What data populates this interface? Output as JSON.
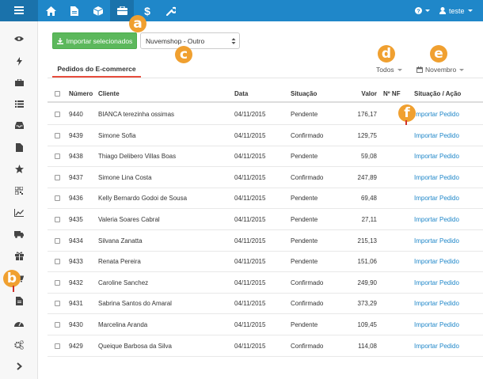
{
  "topbar": {
    "icons": [
      "menu-icon",
      "home-icon",
      "document-icon",
      "box-icon",
      "briefcase-icon",
      "dollar-icon",
      "wrench-icon"
    ],
    "help_icon": "question-circle-icon",
    "user_icon": "user-icon",
    "user_label": "teste"
  },
  "sidebar": {
    "icons": [
      "eye-icon",
      "bolt-icon",
      "briefcase-icon",
      "list-icon",
      "inbox-icon",
      "file-icon",
      "star-icon",
      "qrcode-icon",
      "line-chart-icon",
      "truck-icon",
      "gift-icon",
      "cart-icon",
      "file-text-icon",
      "dashboard-icon",
      "cogs-icon",
      "chevron-right-icon"
    ]
  },
  "toolbar": {
    "import_label": "Importar selecionados",
    "store_select": "Nuvemshop - Outro"
  },
  "tabs": {
    "active_label": "Pedidos do E-commerce"
  },
  "filters": {
    "status_label": "Todos",
    "month_label": "Novembro"
  },
  "table": {
    "headers": [
      "Número",
      "Cliente",
      "Data",
      "Situação",
      "Valor",
      "Nº NF",
      "Situação / Ação"
    ],
    "rows": [
      {
        "numero": "9440",
        "cliente": "BIANCA terezinha ossimas",
        "data": "04/11/2015",
        "situacao": "Pendente",
        "valor": "176,17",
        "nf": "",
        "acao": "Importar Pedido"
      },
      {
        "numero": "9439",
        "cliente": "Simone Sofia",
        "data": "04/11/2015",
        "situacao": "Confirmado",
        "valor": "129,75",
        "nf": "",
        "acao": "Importar Pedido"
      },
      {
        "numero": "9438",
        "cliente": "Thiago Delibero Villas Boas",
        "data": "04/11/2015",
        "situacao": "Pendente",
        "valor": "59,08",
        "nf": "",
        "acao": "Importar Pedido"
      },
      {
        "numero": "9437",
        "cliente": "Simone Lina Costa",
        "data": "04/11/2015",
        "situacao": "Confirmado",
        "valor": "247,89",
        "nf": "",
        "acao": "Importar Pedido"
      },
      {
        "numero": "9436",
        "cliente": "Kelly Bernardo Godoi de Sousa",
        "data": "04/11/2015",
        "situacao": "Pendente",
        "valor": "69,48",
        "nf": "",
        "acao": "Importar Pedido"
      },
      {
        "numero": "9435",
        "cliente": "Valeria Soares Cabral",
        "data": "04/11/2015",
        "situacao": "Pendente",
        "valor": "27,11",
        "nf": "",
        "acao": "Importar Pedido"
      },
      {
        "numero": "9434",
        "cliente": "Silvana Zanatta",
        "data": "04/11/2015",
        "situacao": "Pendente",
        "valor": "215,13",
        "nf": "",
        "acao": "Importar Pedido"
      },
      {
        "numero": "9433",
        "cliente": "Renata Pereira",
        "data": "04/11/2015",
        "situacao": "Pendente",
        "valor": "151,06",
        "nf": "",
        "acao": "Importar Pedido"
      },
      {
        "numero": "9432",
        "cliente": "Caroline Sanchez",
        "data": "04/11/2015",
        "situacao": "Confirmado",
        "valor": "249,90",
        "nf": "",
        "acao": "Importar Pedido"
      },
      {
        "numero": "9431",
        "cliente": "Sabrina Santos do Amaral",
        "data": "04/11/2015",
        "situacao": "Confirmado",
        "valor": "373,29",
        "nf": "",
        "acao": "Importar Pedido"
      },
      {
        "numero": "9430",
        "cliente": "Marcelina Aranda",
        "data": "04/11/2015",
        "situacao": "Pendente",
        "valor": "109,45",
        "nf": "",
        "acao": "Importar Pedido"
      },
      {
        "numero": "9429",
        "cliente": "Queique Barbosa da Silva",
        "data": "04/11/2015",
        "situacao": "Confirmado",
        "valor": "114,08",
        "nf": "",
        "acao": "Importar Pedido"
      }
    ]
  },
  "annotations": {
    "a": "a",
    "b": "b",
    "c": "c",
    "d": "d",
    "e": "e",
    "f": "f"
  },
  "colors": {
    "topbar": "#1f87c9",
    "topbar_active": "#1a72ab",
    "import_button": "#5cb85c",
    "link": "#1f87c9",
    "tab_underline": "#e74c3c",
    "annotation": "#f0a030"
  }
}
